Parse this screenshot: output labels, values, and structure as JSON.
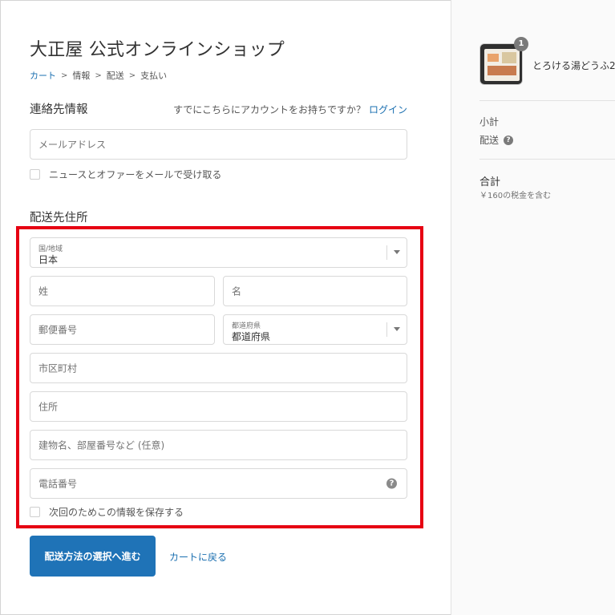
{
  "header": {
    "shop_title": "大正屋 公式オンラインショップ",
    "breadcrumb": [
      {
        "label": "カート"
      },
      {
        "label": "情報"
      },
      {
        "label": "配送"
      },
      {
        "label": "支払い"
      }
    ],
    "breadcrumb_separator": ">"
  },
  "contact": {
    "title": "連絡先情報",
    "account_prompt": "すでにこちらにアカウントをお持ちですか？",
    "login_link": "ログイン",
    "email_placeholder": "メールアドレス",
    "newsletter_label": "ニュースとオファーをメールで受け取る",
    "newsletter_checked": false
  },
  "shipping": {
    "title": "配送先住所",
    "country": {
      "label": "国/地域",
      "value": "日本"
    },
    "last_name_placeholder": "姓",
    "first_name_placeholder": "名",
    "postal_placeholder": "郵便番号",
    "prefecture": {
      "label": "都道府県",
      "value": "都道府県"
    },
    "city_placeholder": "市区町村",
    "address_placeholder": "住所",
    "building_placeholder": "建物名、部屋番号など (任意)",
    "phone_placeholder": "電話番号",
    "save_info_label": "次回のためこの情報を保存する",
    "save_info_checked": false
  },
  "actions": {
    "continue_button": "配送方法の選択へ進む",
    "back_link": "カートに戻る"
  },
  "summary": {
    "item_count": "1",
    "product_name": "とろける湯どうふ2",
    "subtotal_label": "小計",
    "shipping_label": "配送",
    "total_label": "合計",
    "tax_note": "￥160の税金を含む"
  },
  "colors": {
    "accent": "#1f73b7",
    "link": "#1a6fb0",
    "highlight": "#e60012",
    "sidebar_bg": "#fafafa"
  },
  "icons": {
    "help": "question-circle-icon",
    "caret": "chevron-down-icon"
  }
}
